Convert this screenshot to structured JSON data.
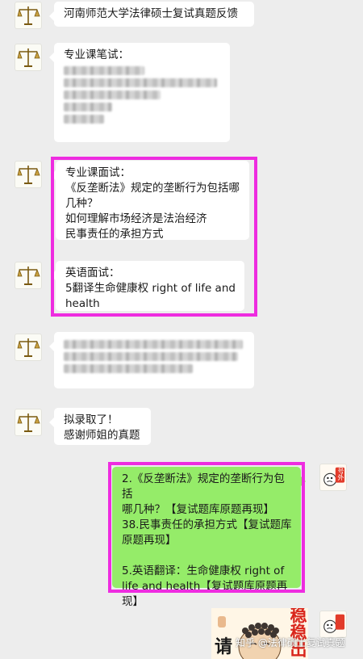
{
  "messages": {
    "m1": {
      "text": "河南师范大学法律硕士复试真题反馈"
    },
    "m2": {
      "lines": [
        "专业课笔试："
      ]
    },
    "m3": {
      "lines": [
        "专业课面试：",
        "《反垄断法》规定的垄断行为包括哪",
        "几种？",
        "如何理解市场经济是法治经济",
        "民事责任的承担方式"
      ]
    },
    "m4": {
      "lines": [
        "英语面试：",
        "5翻译生命健康权 right of life and",
        "health"
      ]
    },
    "m6": {
      "lines": [
        "拟录取了！",
        "感谢师姐的真题"
      ]
    },
    "m7": {
      "lines": [
        "2.《反垄断法》规定的垄断行为包括",
        "哪几种？【复试题库原题再现】",
        "38.民事责任的承担方式【复试题库",
        "原题再现】",
        "",
        "5.英语翻译：生命健康权 right of",
        "life and health【复试题库原题再",
        "现】"
      ]
    }
  },
  "sticker": {
    "chars_right": "稳稳出",
    "chars_left": "请"
  },
  "watermark": "知乎 @法律硕士复试真题",
  "self_avatar": {
    "label": "号外"
  },
  "colors": {
    "highlight": "#ee2ce0",
    "self_bubble": "#95ec69",
    "background": "#ededed"
  }
}
